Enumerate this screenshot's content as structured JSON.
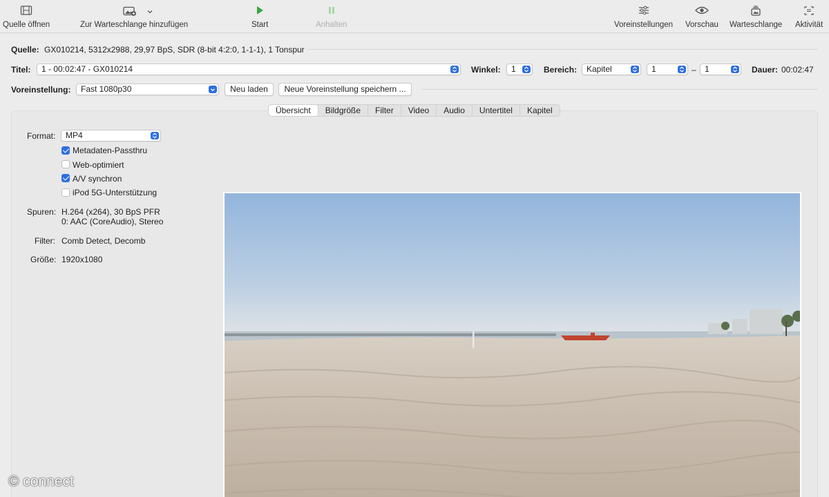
{
  "toolbar": {
    "open_source": "Quelle öffnen",
    "add_to_queue": "Zur Warteschlange hinzufügen",
    "start": "Start",
    "pause": "Anhalten",
    "presets": "Voreinstellungen",
    "preview": "Vorschau",
    "queue": "Warteschlange",
    "activity": "Aktivität"
  },
  "source": {
    "label": "Quelle:",
    "value": "GX010214, 5312x2988, 29,97 BpS, SDR (8-bit 4:2:0, 1-1-1), 1 Tonspur"
  },
  "title_row": {
    "label": "Titel:",
    "value": "1 - 00:02:47 - GX010214",
    "angle_label": "Winkel:",
    "angle_value": "1",
    "range_label": "Bereich:",
    "range_type": "Kapitel",
    "range_from": "1",
    "range_sep": "–",
    "range_to": "1",
    "duration_label": "Dauer:",
    "duration_value": "00:02:47"
  },
  "preset_row": {
    "label": "Voreinstellung:",
    "value": "Fast 1080p30",
    "reload_button": "Neu laden",
    "save_button": "Neue Voreinstellung speichern ..."
  },
  "tabs": [
    "Übersicht",
    "Bildgröße",
    "Filter",
    "Video",
    "Audio",
    "Untertitel",
    "Kapitel"
  ],
  "summary": {
    "format_label": "Format:",
    "format_value": "MP4",
    "checkboxes": [
      {
        "label": "Metadaten-Passthru",
        "checked": true
      },
      {
        "label": "Web-optimiert",
        "checked": false
      },
      {
        "label": "A/V synchron",
        "checked": true
      },
      {
        "label": "iPod 5G-Unterstützung",
        "checked": false
      }
    ],
    "tracks_label": "Spuren:",
    "tracks_line1": "H.264 (x264), 30 BpS PFR",
    "tracks_line2": "0: AAC (CoreAudio), Stereo",
    "filters_label": "Filter:",
    "filters_value": "Comb Detect, Decomb",
    "size_label": "Größe:",
    "size_value": "1920x1080"
  },
  "watermark": "© connect",
  "colors": {
    "accent": "#2d6fe0",
    "start_green": "#3aa640",
    "background": "#ececec"
  }
}
